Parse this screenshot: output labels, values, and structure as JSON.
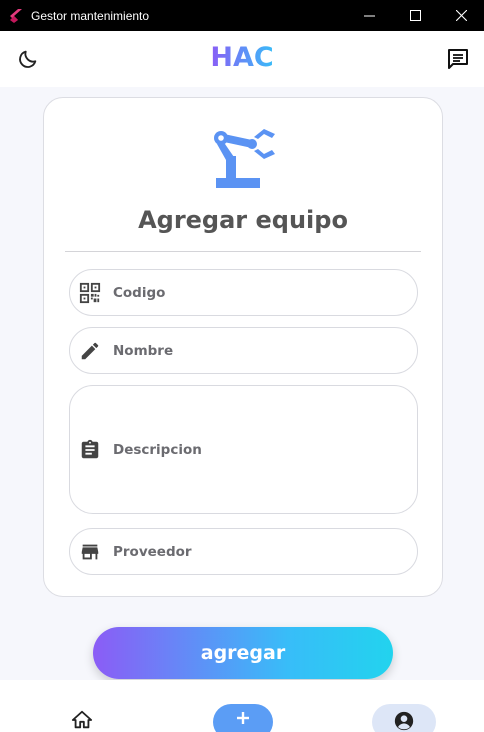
{
  "window": {
    "title": "Gestor mantenimiento",
    "controls": [
      "minimize-icon",
      "maximize-icon",
      "close-icon"
    ]
  },
  "appbar": {
    "brand": "HAC",
    "left_icon": "moon-icon",
    "right_icon": "chat-icon"
  },
  "form": {
    "icon": "robot-arm-icon",
    "title": "Agregar equipo",
    "fields": [
      {
        "placeholder": "Codigo",
        "icon": "qr-code-icon"
      },
      {
        "placeholder": "Nombre",
        "icon": "pencil-icon"
      },
      {
        "placeholder": "Descripcion",
        "icon": "clipboard-icon"
      },
      {
        "placeholder": "Proveedor",
        "icon": "store-icon"
      }
    ],
    "submit_label": "agregar"
  },
  "bottom_nav": {
    "items": [
      {
        "icon": "home-icon"
      },
      {
        "icon": "plus-icon",
        "active": true
      },
      {
        "icon": "account-icon"
      }
    ]
  },
  "colors": {
    "brand_gradient_start": "#8b5cf6",
    "brand_gradient_end": "#38bdf8",
    "primary_blue": "#5b9df5",
    "robot_icon": "#5b93f3",
    "card_border": "#dcdde3",
    "text_gray": "#555555"
  }
}
